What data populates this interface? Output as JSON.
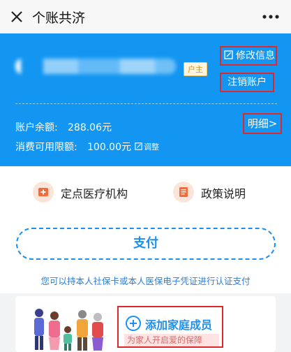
{
  "window": {
    "title": "个账共济"
  },
  "account_card": {
    "owner_badge": "户主",
    "edit_label": "修改信息",
    "cancel_label": "注销账户",
    "balance_label": "账户余额:",
    "balance_value": "288.06元",
    "limit_label": "消费可用限额:",
    "limit_value": "100.00元",
    "adjust_label": "调整",
    "detail_label": "明细>",
    "colors": {
      "card_bg": "#1296f2",
      "highlight_border": "#e0272c"
    }
  },
  "quick_links": [
    {
      "label": "定点医疗机构",
      "icon": "hospital-plus-icon"
    },
    {
      "label": "政策说明",
      "icon": "document-icon"
    }
  ],
  "pay": {
    "button_label": "支付",
    "hint": "您可以持本人社保卡或本人医保电子凭证进行认证支付"
  },
  "family": {
    "add_label": "添加家庭成员",
    "add_sub": "为家人开启爱的保障"
  }
}
